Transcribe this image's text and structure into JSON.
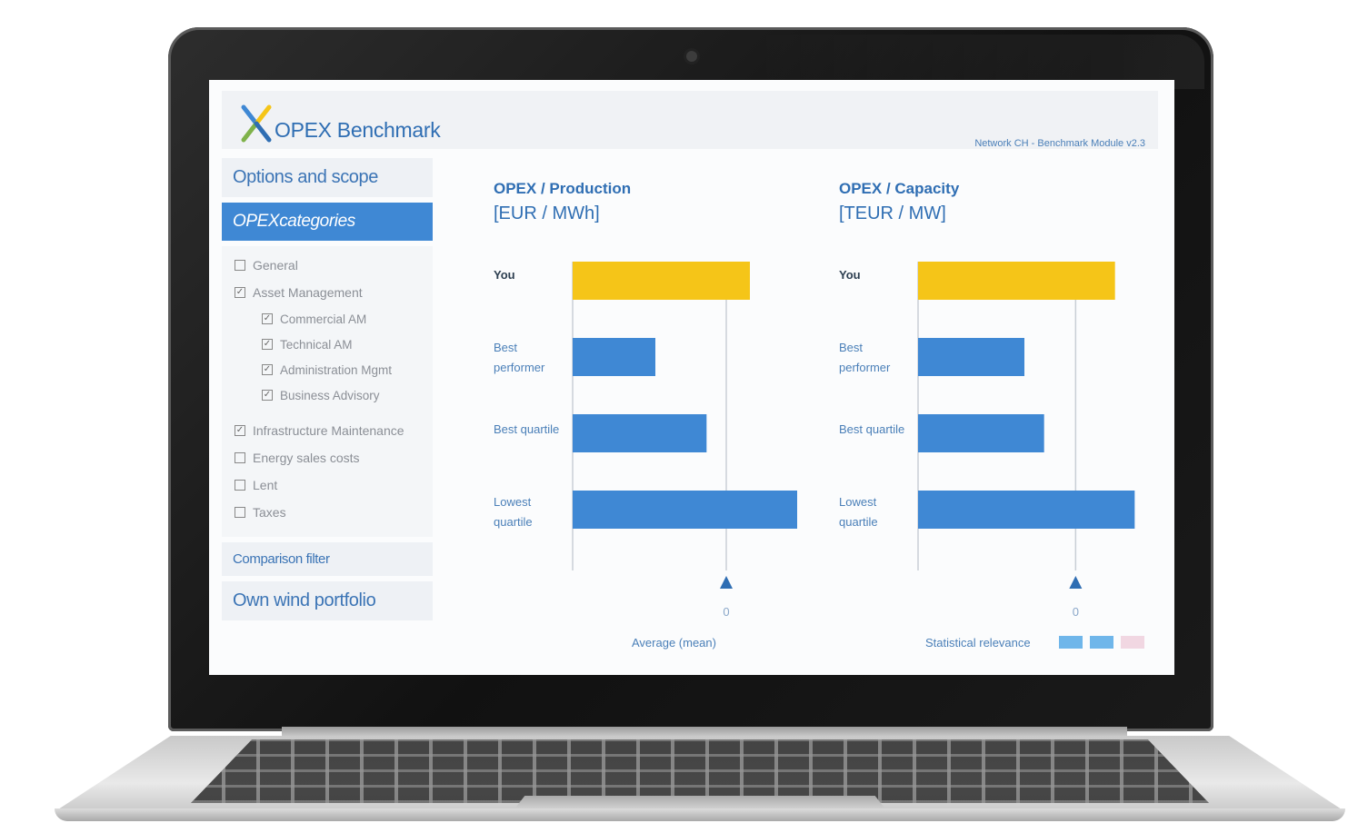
{
  "app": {
    "title": "OPEX Benchmark",
    "header_right": "Network CH - Benchmark Module v2.3",
    "logo_colors": [
      "#3f88d4",
      "#f5c518",
      "#7fb24a",
      "#2f6eb3"
    ]
  },
  "sidebar": {
    "options_label": "Options and scope",
    "categories_label": "OPEXcategories",
    "categories": [
      {
        "label": "General",
        "checked": false,
        "level": 0
      },
      {
        "label": "Asset Management",
        "checked": true,
        "level": 0
      },
      {
        "label": "Commercial AM",
        "checked": true,
        "level": 1
      },
      {
        "label": "Technical AM",
        "checked": true,
        "level": 1
      },
      {
        "label": "Administration Mgmt",
        "checked": true,
        "level": 1
      },
      {
        "label": "Business Advisory",
        "checked": true,
        "level": 1
      },
      {
        "label": "Infrastructure Maintenance",
        "checked": true,
        "level": 0
      },
      {
        "label": "Energy sales costs",
        "checked": false,
        "level": 0
      },
      {
        "label": "Lent",
        "checked": false,
        "level": 0
      },
      {
        "label": "Taxes",
        "checked": false,
        "level": 0
      }
    ],
    "comparison_label": "Comparison filter",
    "portfolio_label": "Own wind portfolio"
  },
  "charts": {
    "left": {
      "title": "OPEX / Production",
      "unit": "[EUR / MWh]",
      "avg_label": "0"
    },
    "right": {
      "title": "OPEX / Capacity",
      "unit": "[TEUR / MW]",
      "avg_label": "0"
    }
  },
  "chart_data": [
    {
      "type": "bar",
      "title": "OPEX / Production",
      "ylabel": "[EUR / MWh]",
      "categories": [
        "You",
        "Best performer",
        "Best quartile",
        "Lowest quartile"
      ],
      "values": [
        45,
        21,
        34,
        57
      ],
      "reference_line": 39,
      "colors": [
        "#f5c518",
        "#3f88d4",
        "#3f88d4",
        "#3f88d4"
      ],
      "xlim": [
        0,
        60
      ]
    },
    {
      "type": "bar",
      "title": "OPEX / Capacity",
      "ylabel": "[TEUR / MW]",
      "categories": [
        "You",
        "Best performer",
        "Best quartile",
        "Lowest quartile"
      ],
      "values": [
        50,
        27,
        32,
        55
      ],
      "reference_line": 40,
      "colors": [
        "#f5c518",
        "#3f88d4",
        "#3f88d4",
        "#3f88d4"
      ],
      "xlim": [
        0,
        60
      ]
    }
  ],
  "footer": {
    "average_label": "Average (mean)",
    "stat_label": "Statistical relevance",
    "legend_colors": [
      "#6fb6ea",
      "#6fb6ea",
      "#f1d7e2"
    ]
  }
}
